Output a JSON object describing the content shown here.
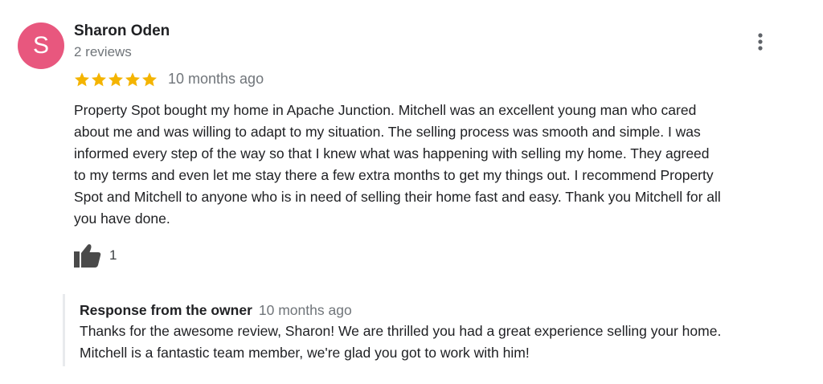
{
  "reviewer": {
    "initial": "S",
    "avatar_color": "#e8577e",
    "name": "Sharon Oden",
    "review_count": "2 reviews"
  },
  "review": {
    "rating": 5,
    "star_color": "#f4b400",
    "time": "10 months ago",
    "text": "Property Spot bought my home in Apache Junction. Mitchell was an excellent young man who cared\nabout me and was willing to adapt to my situation. The selling process was smooth and simple. I was\ninformed every step of the way so that I knew what was happening with selling my home.  They agreed\nto my terms and even let me stay there a few extra months to get my things out. I recommend Property\nSpot and Mitchell to anyone who is in need of selling their home fast and easy. Thank you Mitchell for all\nyou have done.",
    "like_count": "1"
  },
  "owner_response": {
    "title": "Response from the owner",
    "time": "10 months ago",
    "text": "Thanks for the awesome review, Sharon! We are thrilled you had a great experience selling your home.\nMitchell is a fantastic team member, we're glad you got to work with him!"
  },
  "icons": {
    "more": "more-vert-icon",
    "like": "thumbs-up-icon",
    "star": "star-icon"
  }
}
